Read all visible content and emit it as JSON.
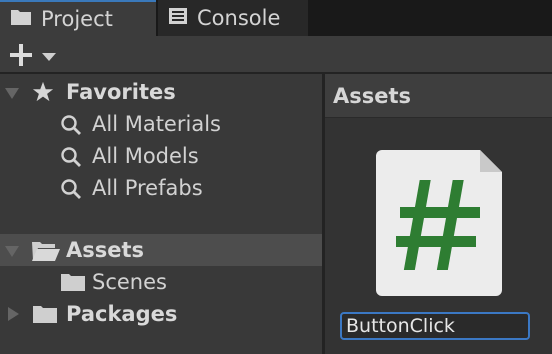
{
  "tabs": [
    {
      "label": "Project",
      "icon": "folder-icon",
      "active": true
    },
    {
      "label": "Console",
      "icon": "console-icon",
      "active": false
    }
  ],
  "toolbar": {
    "add_icon": "plus-icon",
    "dropdown_icon": "caret-down-icon"
  },
  "tree": {
    "favorites": {
      "label": "Favorites",
      "items": [
        {
          "label": "All Materials"
        },
        {
          "label": "All Models"
        },
        {
          "label": "All Prefabs"
        }
      ]
    },
    "assets": {
      "label": "Assets",
      "children": [
        {
          "label": "Scenes"
        }
      ]
    },
    "packages": {
      "label": "Packages"
    }
  },
  "content": {
    "header": "Assets",
    "asset": {
      "type": "C# script",
      "glyph": "#",
      "glyph_color": "#2e7d32",
      "name_value": "ButtonClick"
    }
  },
  "colors": {
    "accent": "#3a79bb",
    "script_green": "#2e7d32",
    "selection": "#4d4d4d"
  }
}
